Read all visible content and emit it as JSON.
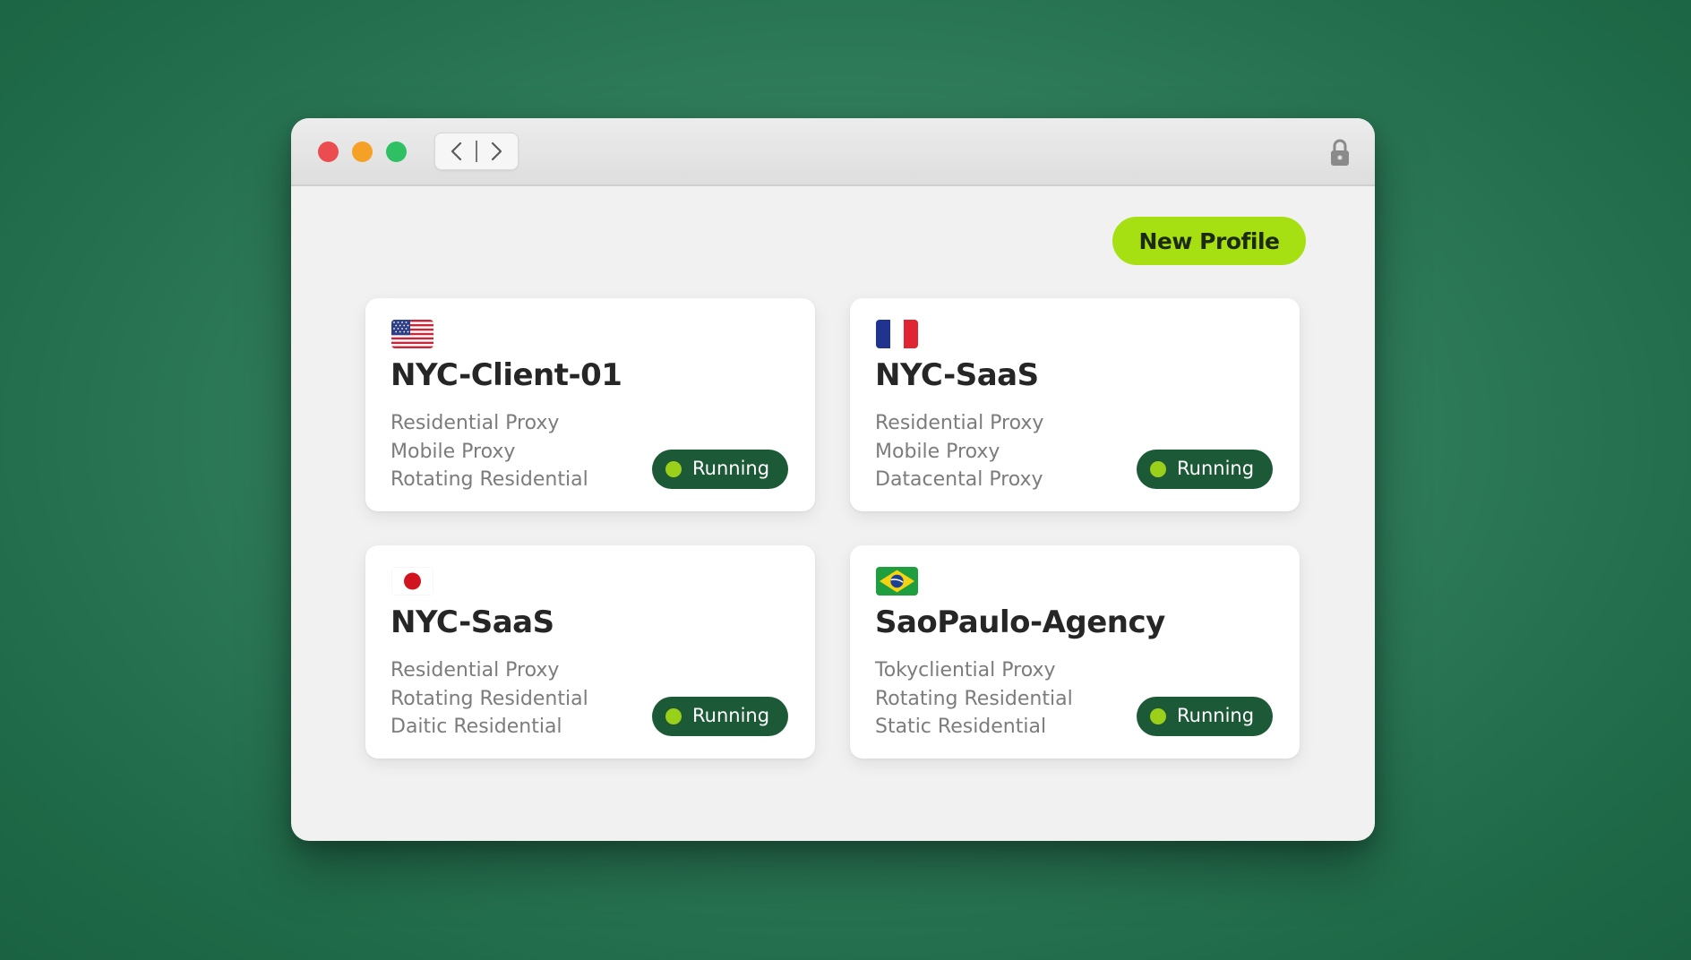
{
  "toolbar": {
    "back_icon": "chevron-left-icon",
    "forward_icon": "chevron-right-icon",
    "lock_icon": "lock-icon"
  },
  "actions": {
    "new_profile_label": "New Profile"
  },
  "profiles": [
    {
      "flag": "us-flag-icon",
      "name": "NYC-Client-01",
      "proxies": [
        "Residential Proxy",
        "Mobile Proxy",
        "Rotating Residential"
      ],
      "status": "Running"
    },
    {
      "flag": "fr-flag-icon",
      "name": "NYC-SaaS",
      "proxies": [
        "Residential Proxy",
        "Mobile Proxy",
        "Datacental Proxy"
      ],
      "status": "Running"
    },
    {
      "flag": "jp-flag-icon",
      "name": "NYC-SaaS",
      "proxies": [
        "Residential Proxy",
        "Rotating Residential",
        "Daitic Residential"
      ],
      "status": "Running"
    },
    {
      "flag": "br-flag-icon",
      "name": "SaoPaulo-Agency",
      "proxies": [
        "Tokycliential Proxy",
        "Rotating Residential",
        "Static Residential"
      ],
      "status": "Running"
    }
  ],
  "colors": {
    "background": "#2f7c5a",
    "accent": "#a6e013",
    "status_pill": "#1c5a37",
    "status_dot": "#9ad01a"
  }
}
